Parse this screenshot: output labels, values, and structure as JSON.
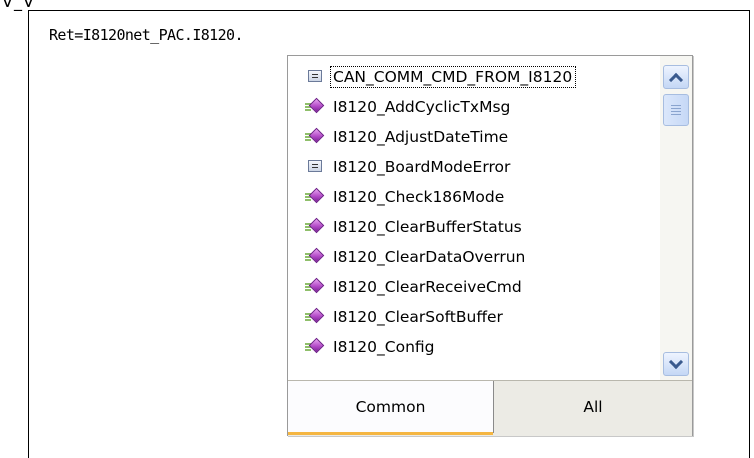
{
  "top_fragment": "Ɐ_Ɐ",
  "editor": {
    "code_line": "Ret=I8120net_PAC.I8120."
  },
  "completion": {
    "items": [
      {
        "label": "CAN_COMM_CMD_FROM_I8120",
        "icon": "struct-icon",
        "selected": true
      },
      {
        "label": "I8120_AddCyclicTxMsg",
        "icon": "method-icon"
      },
      {
        "label": "I8120_AdjustDateTime",
        "icon": "method-icon"
      },
      {
        "label": "I8120_BoardModeError",
        "icon": "struct-icon"
      },
      {
        "label": "I8120_Check186Mode",
        "icon": "method-icon"
      },
      {
        "label": "I8120_ClearBufferStatus",
        "icon": "method-icon"
      },
      {
        "label": "I8120_ClearDataOverrun",
        "icon": "method-icon"
      },
      {
        "label": "I8120_ClearReceiveCmd",
        "icon": "method-icon"
      },
      {
        "label": "I8120_ClearSoftBuffer",
        "icon": "method-icon"
      },
      {
        "label": "I8120_Config",
        "icon": "method-icon"
      }
    ],
    "tabs": {
      "common": "Common",
      "all": "All",
      "active": "common"
    }
  },
  "colors": {
    "active_tab_underline": "#f5b642",
    "method_icon": "#b44cc8",
    "scrollbar_button": "#c4d7f5"
  }
}
